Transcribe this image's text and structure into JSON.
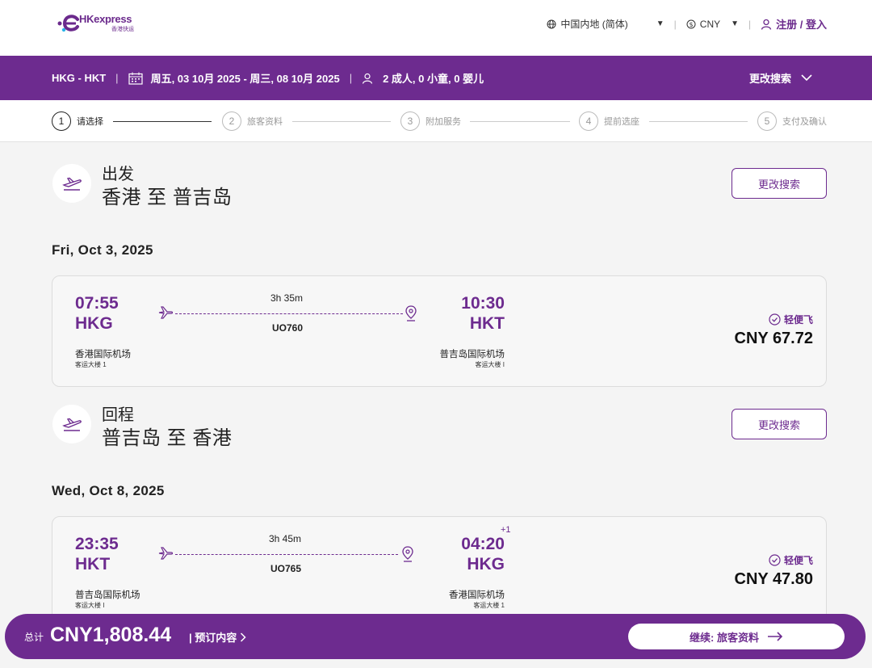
{
  "header": {
    "logo_text": "HKexpress",
    "logo_sub": "香港快运",
    "region": "中国内地 (简体)",
    "currency": "CNY",
    "login": "注册 / 登入"
  },
  "summary": {
    "route": "HKG - HKT",
    "dates": "周五, 03 10月 2025 - 周三, 08 10月 2025",
    "passengers": "2 成人, 0 小童, 0 婴儿",
    "change": "更改搜索"
  },
  "steps": [
    {
      "num": "1",
      "label": "请选择"
    },
    {
      "num": "2",
      "label": "旅客资料"
    },
    {
      "num": "3",
      "label": "附加服务"
    },
    {
      "num": "4",
      "label": "提前选座"
    },
    {
      "num": "5",
      "label": "支付及确认"
    }
  ],
  "outbound": {
    "label": "出发",
    "route": "香港 至 普吉岛",
    "change": "更改搜索",
    "date": "Fri, Oct 3, 2025",
    "flight": {
      "dep_time": "07:55",
      "dep_code": "HKG",
      "dep_airport": "香港国际机场",
      "dep_terminal": "客运大楼 1",
      "arr_time": "10:30",
      "arr_code": "HKT",
      "arr_airport": "普吉岛国际机场",
      "arr_terminal": "客运大楼 I",
      "duration": "3h 35m",
      "flight_no": "UO760",
      "fare": "轻便飞",
      "price": "CNY 67.72"
    }
  },
  "return": {
    "label": "回程",
    "route": "普吉岛 至 香港",
    "change": "更改搜索",
    "date": "Wed, Oct 8, 2025",
    "flight": {
      "dep_time": "23:35",
      "dep_code": "HKT",
      "dep_airport": "普吉岛国际机场",
      "dep_terminal": "客运大楼 I",
      "arr_time": "04:20",
      "arr_code": "HKG",
      "arr_airport": "香港国际机场",
      "arr_terminal": "客运大楼 1",
      "plus_day": "+1",
      "duration": "3h 45m",
      "flight_no": "UO765",
      "fare": "轻便飞",
      "price": "CNY 47.80"
    }
  },
  "footer": {
    "total_label": "总计",
    "total": "CNY1,808.44",
    "details": "| 预订内容",
    "continue": "继续: 旅客资料"
  },
  "colors": {
    "brand": "#6d2b8f"
  }
}
